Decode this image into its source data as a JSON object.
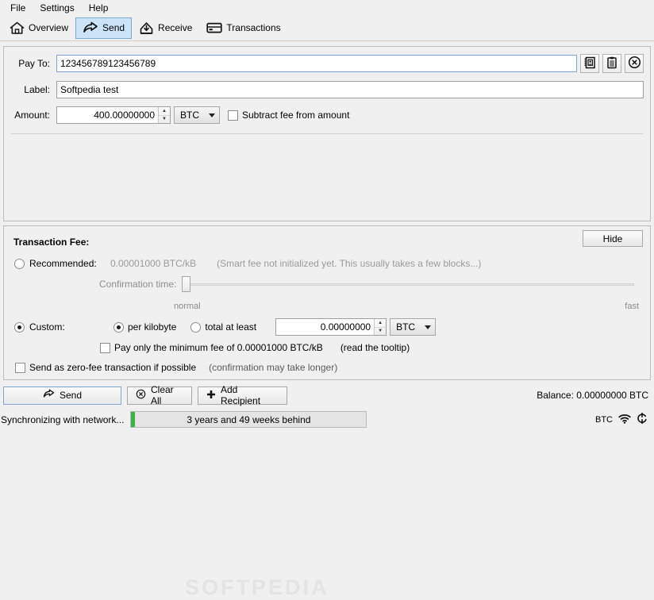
{
  "menubar": {
    "items": [
      {
        "label": "File"
      },
      {
        "label": "Settings"
      },
      {
        "label": "Help"
      }
    ]
  },
  "toolbar": {
    "tabs": [
      {
        "label": "Overview",
        "icon": "home-icon",
        "active": false
      },
      {
        "label": "Send",
        "icon": "send-arrow-icon",
        "active": true
      },
      {
        "label": "Receive",
        "icon": "inbox-arrow-icon",
        "active": false
      },
      {
        "label": "Transactions",
        "icon": "card-icon",
        "active": false
      }
    ]
  },
  "form": {
    "payto_label": "Pay To:",
    "payto_value": "123456789123456789",
    "label_label": "Label:",
    "label_value": "Softpedia test",
    "amount_label": "Amount:",
    "amount_value": "400.00000000",
    "amount_unit": "BTC",
    "subtract_fee_label": "Subtract fee from amount",
    "buttons": {
      "addressbook": "address-book-icon",
      "paste": "paste-clipboard-icon",
      "clear": "clear-circle-x-icon"
    }
  },
  "fee": {
    "title": "Transaction Fee:",
    "hide_label": "Hide",
    "recommended_label": "Recommended:",
    "recommended_value": "0.00001000 BTC/kB",
    "smartfee_note": "(Smart fee not initialized yet. This usually takes a few blocks...)",
    "confirmation_label": "Confirmation time:",
    "slider_min_label": "normal",
    "slider_max_label": "fast",
    "custom_label": "Custom:",
    "per_kilobyte_label": "per kilobyte",
    "total_at_least_label": "total at least",
    "custom_amount_value": "0.00000000",
    "custom_unit": "BTC",
    "min_fee_label": "Pay only the minimum fee of 0.00001000 BTC/kB",
    "tooltip_note": "(read the tooltip)",
    "zero_fee_label": "Send as zero-fee transaction if possible",
    "zero_fee_note": "(confirmation may take longer)"
  },
  "actions": {
    "send_label": "Send",
    "clear_all_label": "Clear All",
    "add_recipient_label": "Add Recipient",
    "balance_label": "Balance: 0.00000000 BTC"
  },
  "status": {
    "sync_text": "Synchronizing with network...",
    "progress_text": "3 years and 49 weeks behind",
    "unit_label": "BTC",
    "network_icon": "network-signal-icon",
    "sync_icon": "sync-arrows-icon"
  },
  "watermark": "SOFTPEDIA",
  "colors": {
    "accent": "#cce4f7",
    "accent_border": "#7aa9d4",
    "progress_green": "#3cb34a",
    "window_bg": "#f0f0f0"
  }
}
